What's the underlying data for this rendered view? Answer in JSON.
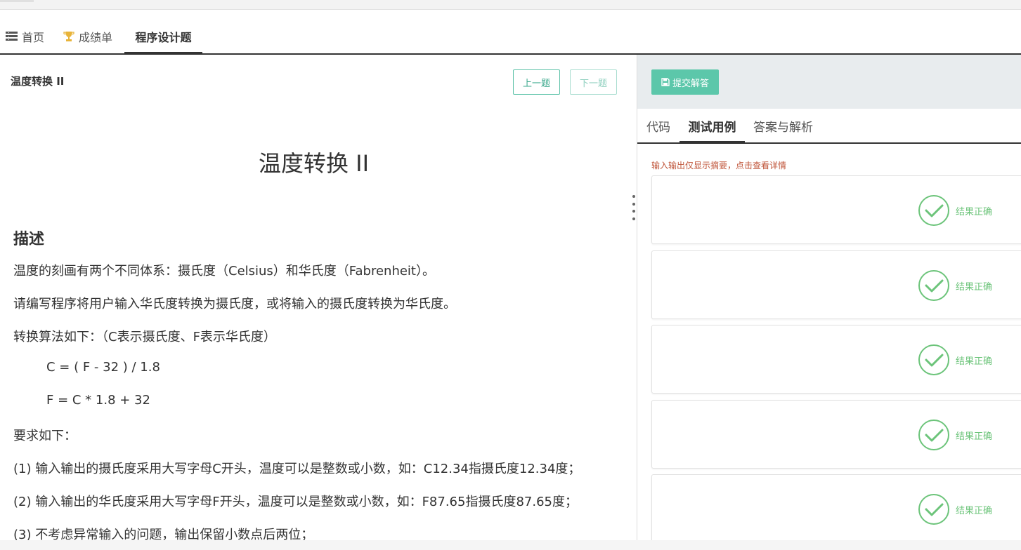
{
  "nav": {
    "tabs": [
      {
        "label": "首页",
        "icon": "list-icon"
      },
      {
        "label": "成绩单",
        "icon": "trophy-icon"
      },
      {
        "label": "程序设计题",
        "icon": ""
      }
    ],
    "active": 2
  },
  "problem": {
    "title_small": "温度转换 II",
    "prev_label": "上一题",
    "next_label": "下一题",
    "title_big": "温度转换 II",
    "desc_heading": "描述",
    "paragraphs": [
      "温度的刻画有两个不同体系：摄氏度（Celsius）和华氏度（Fabrenheit）。",
      "请编写程序将用户输入华氏度转换为摄氏度，或将输入的摄氏度转换为华氏度。",
      "转换算法如下：（C表示摄氏度、F表示华氏度）",
      "C = ( F - 32 ) / 1.8",
      "F = C * 1.8 + 32",
      "要求如下：",
      "(1) 输入输出的摄氏度采用大写字母C开头，温度可以是整数或小数，如：C12.34指摄氏度12.34度；",
      "(2) 输入输出的华氏度采用大写字母F开头，温度可以是整数或小数，如：F87.65指摄氏度87.65度；",
      "(3) 不考虑异常输入的问题，输出保留小数点后两位；"
    ]
  },
  "right": {
    "submit_label": "提交解答",
    "tabs": [
      "代码",
      "测试用例",
      "答案与解析"
    ],
    "active_tab": 1,
    "hint": "输入输出仅显示摘要，点击查看详情",
    "cases": [
      {
        "result": "结果正确"
      },
      {
        "result": "结果正确"
      },
      {
        "result": "结果正确"
      },
      {
        "result": "结果正确"
      },
      {
        "result": "结果正确"
      }
    ]
  },
  "colors": {
    "accent": "#5cc7aa",
    "success": "#6cc47a",
    "hint": "#c0553a",
    "trophy": "#e8b43a"
  }
}
